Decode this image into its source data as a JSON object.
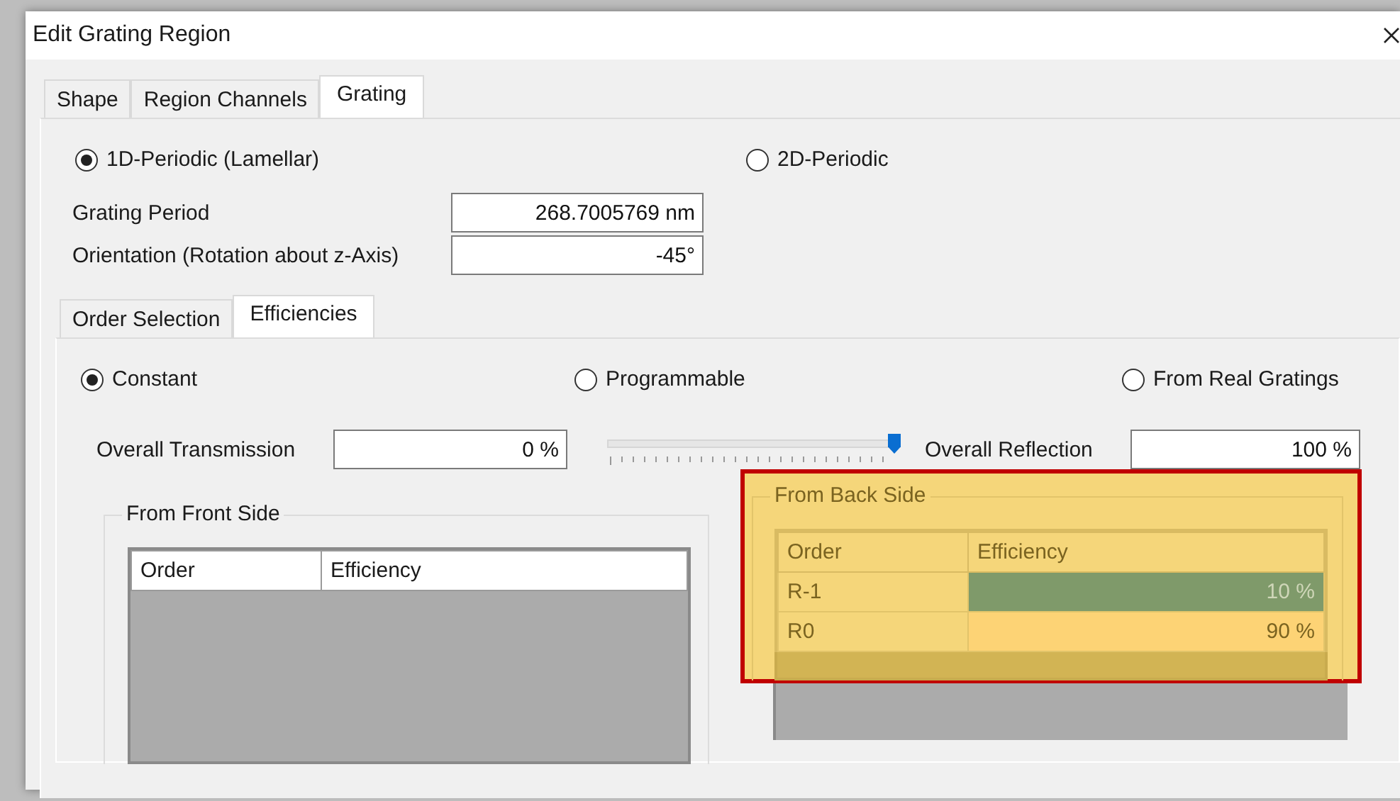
{
  "window": {
    "title": "Edit Grating Region"
  },
  "tabs": [
    {
      "label": "Shape",
      "selected": false
    },
    {
      "label": "Region Channels",
      "selected": false
    },
    {
      "label": "Grating",
      "selected": true
    }
  ],
  "grating_type": [
    {
      "label": "1D-Periodic (Lamellar)",
      "selected": true
    },
    {
      "label": "2D-Periodic",
      "selected": false
    }
  ],
  "fields": [
    {
      "label": "Grating Period",
      "value": "268.7005769 nm"
    },
    {
      "label": "Orientation (Rotation about z-Axis)",
      "value": "-45°"
    }
  ],
  "sub_tabs": [
    {
      "label": "Order Selection",
      "selected": false
    },
    {
      "label": "Efficiencies",
      "selected": true
    }
  ],
  "efficiency_mode": [
    {
      "label": "Constant",
      "selected": true
    },
    {
      "label": "Programmable",
      "selected": false
    },
    {
      "label": "From Real Gratings",
      "selected": false
    }
  ],
  "transmission": {
    "label": "Overall Transmission",
    "value": "0 %"
  },
  "slider": {
    "level": 1.0
  },
  "reflection": {
    "label": "Overall Reflection",
    "value": "100 %"
  },
  "groups": [
    {
      "title": "From Front Side",
      "highlighted": false,
      "columns": [
        "Order",
        "Efficiency"
      ]
    },
    {
      "title": "From Back Side",
      "highlighted": true,
      "columns": [
        "Order",
        "Efficiency"
      ],
      "rows": [
        {
          "order": "R-1",
          "efficiency": "10 %",
          "selected": true
        },
        {
          "order": "R0",
          "efficiency": "90 %",
          "selected": false
        }
      ]
    }
  ]
}
